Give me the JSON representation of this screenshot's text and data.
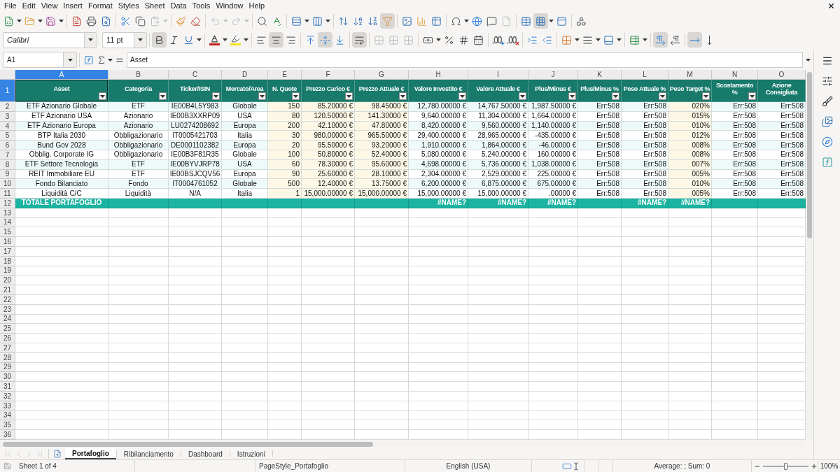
{
  "menu_bar": [
    "File",
    "Edit",
    "View",
    "Insert",
    "Format",
    "Styles",
    "Sheet",
    "Data",
    "Tools",
    "Window",
    "Help"
  ],
  "standard_toolbar": {
    "paste_disabled": true,
    "undo_disabled": true,
    "redo_disabled": true,
    "autofilter_on": true,
    "header_footer_disabled": true,
    "freeze_on": true
  },
  "formatting_toolbar": {
    "font_name": "Calibri",
    "font_size": "11 pt",
    "bold_on": true,
    "italic_on": false,
    "underline_on": false,
    "align_left_on": false,
    "align_center_on": true,
    "align_right_on": false,
    "align_top_on": false,
    "align_middle_on": true,
    "align_bottom_on": false,
    "wrap_text_on": true,
    "merge_disabled": true,
    "left_to_right_on": true,
    "right_to_left_on": false,
    "text_horizontal_on": true,
    "text_vertical_on": false
  },
  "formula_bar": {
    "cell_reference": "A1",
    "content": "Asset"
  },
  "sheet": {
    "columns": [
      {
        "letter": "A",
        "selected": true,
        "heading": "Asset",
        "filter": true,
        "kind": "text"
      },
      {
        "letter": "B",
        "selected": false,
        "heading": "Categoria",
        "filter": true,
        "kind": "text"
      },
      {
        "letter": "C",
        "selected": false,
        "heading": "Ticker/ISIN",
        "filter": true,
        "kind": "text"
      },
      {
        "letter": "D",
        "selected": false,
        "heading": "Mercato/Area",
        "filter": true,
        "kind": "text"
      },
      {
        "letter": "E",
        "selected": false,
        "heading": "N. Quote",
        "filter": true,
        "kind": "input"
      },
      {
        "letter": "F",
        "selected": false,
        "heading": "Prezzo Carico €",
        "filter": true,
        "kind": "input"
      },
      {
        "letter": "G",
        "selected": false,
        "heading": "Prezzo Attuale €",
        "filter": true,
        "kind": "input"
      },
      {
        "letter": "H",
        "selected": false,
        "heading": "Valore Investito €",
        "filter": true,
        "kind": "number"
      },
      {
        "letter": "I",
        "selected": false,
        "heading": "Valore Attuale €",
        "filter": true,
        "kind": "number"
      },
      {
        "letter": "J",
        "selected": false,
        "heading": "Plus/Minus €",
        "filter": true,
        "kind": "number"
      },
      {
        "letter": "K",
        "selected": false,
        "heading": "Plus/Minus %",
        "filter": true,
        "kind": "number"
      },
      {
        "letter": "L",
        "selected": false,
        "heading": "Peso Attuale %",
        "filter": true,
        "kind": "number"
      },
      {
        "letter": "M",
        "selected": false,
        "heading": "Peso Target %",
        "filter": true,
        "kind": "input"
      },
      {
        "letter": "N",
        "selected": false,
        "heading": "Scostamento %",
        "filter": true,
        "kind": "number"
      },
      {
        "letter": "O",
        "selected": false,
        "heading": "Azione Consigliata",
        "filter": false,
        "kind": "number"
      }
    ],
    "header_row": {
      "number": "1",
      "selected": true
    },
    "rows": [
      {
        "number": "2",
        "cells": [
          "ETF Azionario Globale",
          "ETF",
          "IE00B4L5Y983",
          "Globale",
          "150",
          "85.20000 €",
          "98.45000 €",
          "12,780.00000 €",
          "14,767.50000 €",
          "1,987.50000 €",
          "Err:508",
          "Err:508",
          "020%",
          "Err:508",
          "Err:508"
        ]
      },
      {
        "number": "3",
        "cells": [
          "ETF Azionario USA",
          "Azionario",
          "IE00B3XXRP09",
          "USA",
          "80",
          "120.50000 €",
          "141.30000 €",
          "9,640.00000 €",
          "11,304.00000 €",
          "1,664.00000 €",
          "Err:508",
          "Err:508",
          "015%",
          "Err:508",
          "Err:508"
        ]
      },
      {
        "number": "4",
        "cells": [
          "ETF Azionario Europa",
          "Azionario",
          "LU0274208692",
          "Europa",
          "200",
          "42.10000 €",
          "47.80000 €",
          "8,420.00000 €",
          "9,560.00000 €",
          "1,140.00000 €",
          "Err:508",
          "Err:508",
          "010%",
          "Err:508",
          "Err:508"
        ]
      },
      {
        "number": "5",
        "cells": [
          "BTP Italia 2030",
          "Obbligazionario",
          "IT0005421703",
          "Italia",
          "30",
          "980.00000 €",
          "965.50000 €",
          "29,400.00000 €",
          "28,965.00000 €",
          "-435.00000 €",
          "Err:508",
          "Err:508",
          "012%",
          "Err:508",
          "Err:508"
        ]
      },
      {
        "number": "6",
        "cells": [
          "Bund Gov 2028",
          "Obbligazionario",
          "DE0001102382",
          "Europa",
          "20",
          "95.50000 €",
          "93.20000 €",
          "1,910.00000 €",
          "1,864.00000 €",
          "-46.00000 €",
          "Err:508",
          "Err:508",
          "008%",
          "Err:508",
          "Err:508"
        ]
      },
      {
        "number": "7",
        "cells": [
          "Obblig. Corporate IG",
          "Obbligazionario",
          "IE00B3F81R35",
          "Globale",
          "100",
          "50.80000 €",
          "52.40000 €",
          "5,080.00000 €",
          "5,240.00000 €",
          "160.00000 €",
          "Err:508",
          "Err:508",
          "008%",
          "Err:508",
          "Err:508"
        ]
      },
      {
        "number": "8",
        "cells": [
          "ETF Settore Tecnologia",
          "ETF",
          "IE00BYVJRP78",
          "USA",
          "60",
          "78.30000 €",
          "95.60000 €",
          "4,698.00000 €",
          "5,736.00000 €",
          "1,038.00000 €",
          "Err:508",
          "Err:508",
          "007%",
          "Err:508",
          "Err:508"
        ]
      },
      {
        "number": "9",
        "cells": [
          "REIT Immobiliare EU",
          "ETF",
          "IE00BSJCQV56",
          "Europa",
          "90",
          "25.60000 €",
          "28.10000 €",
          "2,304.00000 €",
          "2,529.00000 €",
          "225.00000 €",
          "Err:508",
          "Err:508",
          "005%",
          "Err:508",
          "Err:508"
        ]
      },
      {
        "number": "10",
        "cells": [
          "Fondo Bilanciato",
          "Fondo",
          "IT0004761052",
          "Globale",
          "500",
          "12.40000 €",
          "13.75000 €",
          "6,200.00000 €",
          "6,875.00000 €",
          "675.00000 €",
          "Err:508",
          "Err:508",
          "010%",
          "Err:508",
          "Err:508"
        ]
      },
      {
        "number": "11",
        "cells": [
          "Liquidità C/C",
          "Liquidità",
          "N/A",
          "Italia",
          "1",
          "15,000.00000 €",
          "15,000.00000 €",
          "15,000.00000 €",
          "15,000.00000 €",
          ".00000 €",
          "Err:508",
          "Err:508",
          "005%",
          "Err:508",
          "Err:508"
        ]
      }
    ],
    "total_row": {
      "number": "12",
      "cells": [
        {
          "kind": "value",
          "text": "TOTALE PORTAFOGLIO"
        },
        {
          "kind": "blank"
        },
        {
          "kind": "blank"
        },
        {
          "kind": "blank"
        },
        {
          "kind": "blank"
        },
        {
          "kind": "blank"
        },
        {
          "kind": "blank"
        },
        {
          "kind": "value",
          "text": "#NAME?"
        },
        {
          "kind": "value",
          "text": "#NAME?"
        },
        {
          "kind": "value",
          "text": "#NAME?"
        },
        {
          "kind": "blank"
        },
        {
          "kind": "value",
          "text": "#NAME?"
        },
        {
          "kind": "value",
          "text": "#NAME?"
        },
        {
          "kind": "blank"
        },
        {
          "kind": "blank"
        }
      ]
    },
    "empty_rows": [
      "13",
      "14",
      "15",
      "16",
      "17",
      "18",
      "19",
      "20",
      "21",
      "22",
      "23",
      "24",
      "25",
      "26",
      "27",
      "28",
      "29",
      "30",
      "31",
      "32",
      "33",
      "34",
      "35",
      "36"
    ]
  },
  "sheet_tabs": {
    "navigation_disabled": true,
    "tabs": [
      {
        "label": "Portafoglio",
        "selected": true
      },
      {
        "label": "Ribilanciamento",
        "selected": false
      },
      {
        "label": "Dashboard",
        "selected": false
      },
      {
        "label": "Istruzioni",
        "selected": false
      }
    ]
  },
  "status_bar": {
    "sheet": "Sheet 1 of 4",
    "page_style": "PageStyle_Portafoglio",
    "language": "English (USA)",
    "summary": "Average: ; Sum: 0",
    "zoom_slider": {
      "level": 0.5
    },
    "zoom": "100%"
  }
}
